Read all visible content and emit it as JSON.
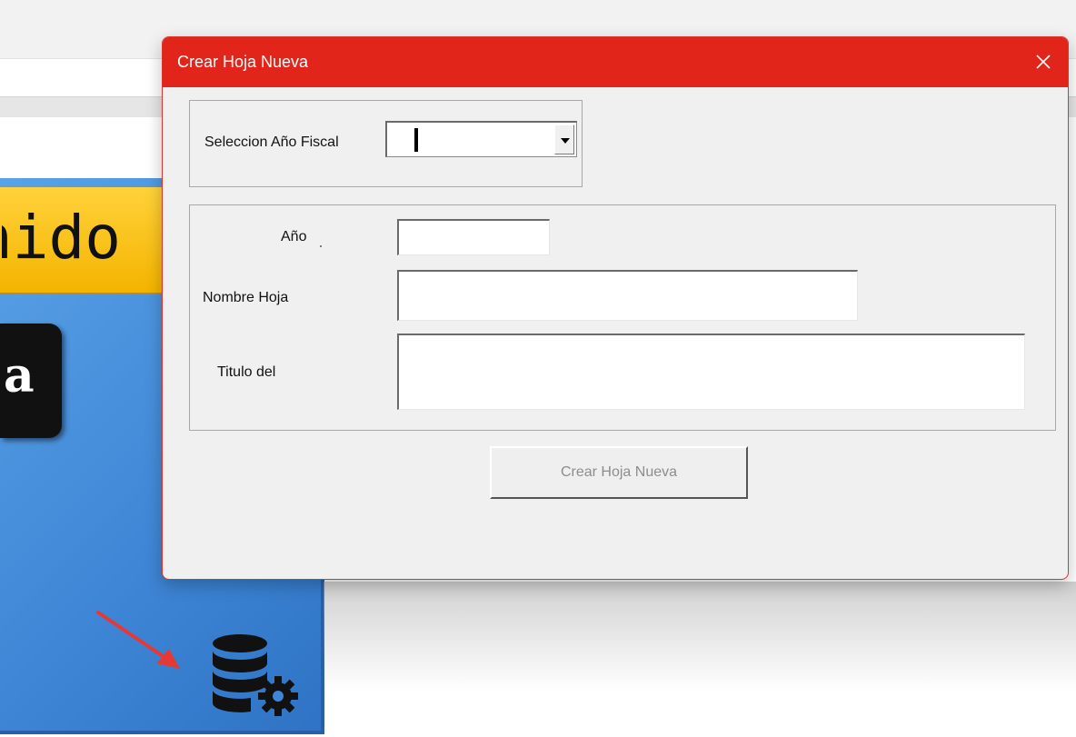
{
  "background": {
    "tile_title_fragment": "nido",
    "tile_black_fragment": "a",
    "tile_color": "#4a90e2",
    "tile_title_color": "#f4b400"
  },
  "dialog": {
    "title": "Crear Hoja Nueva",
    "title_bar_color": "#e1251b",
    "close_icon": "close-icon",
    "fiscal_year": {
      "label": "Seleccion Año Fiscal",
      "selected_value": ""
    },
    "fields": {
      "ano_label": "Año",
      "ano_value": "",
      "nombre_label": "Nombre Hoja",
      "nombre_value": "",
      "titulo_label": "Titulo del",
      "titulo_value": ""
    },
    "create_button_label": "Crear Hoja Nueva"
  },
  "annotation": {
    "arrow_color": "#e53935",
    "arrow_icon": "arrow-icon",
    "database_icon": "database-gear-icon"
  }
}
